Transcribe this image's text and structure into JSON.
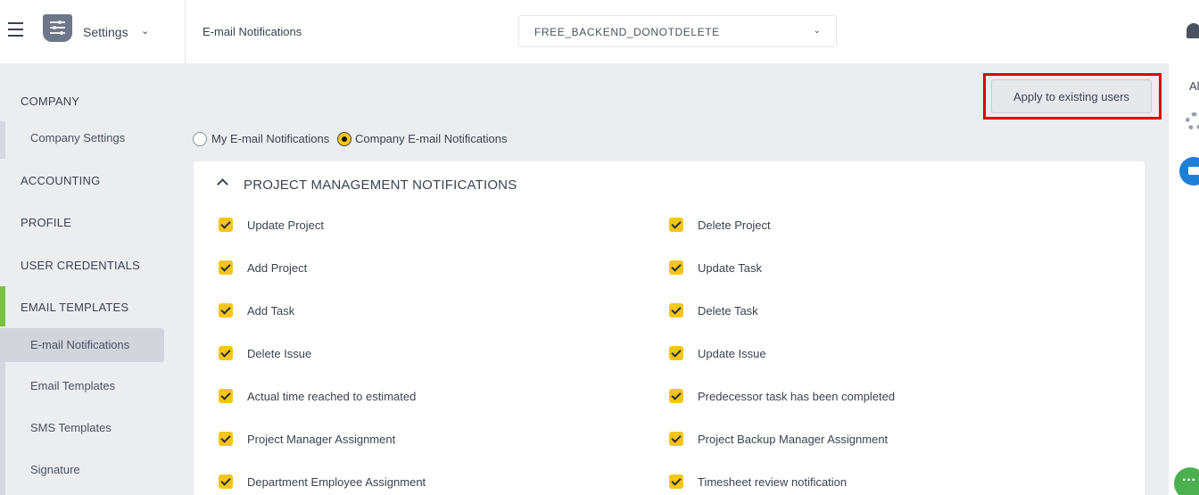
{
  "header": {
    "menu_icon": "hamburger-icon",
    "app_label": "Settings",
    "page_title": "E-mail Notifications",
    "company_select": "FREE_BACKEND_DONOTDELETE"
  },
  "right_rail": {
    "text": "Al",
    "icons": [
      "bell-icon",
      "gear-icon",
      "mail-icon",
      "chat-icon"
    ]
  },
  "sidebar": {
    "sections": [
      {
        "label": "COMPANY"
      },
      {
        "label": "ACCOUNTING"
      },
      {
        "label": "PROFILE"
      },
      {
        "label": "USER CREDENTIALS"
      },
      {
        "label": "EMAIL TEMPLATES"
      }
    ],
    "items": [
      {
        "label": "Company Settings"
      },
      {
        "label": "E-mail Notifications",
        "active": true
      },
      {
        "label": "Email Templates"
      },
      {
        "label": "SMS Templates"
      },
      {
        "label": "Signature"
      }
    ]
  },
  "main": {
    "apply_button": "Apply to existing users",
    "radios": [
      {
        "label": "My E-mail Notifications",
        "checked": false
      },
      {
        "label": "Company E-mail Notifications",
        "checked": true
      }
    ],
    "section_title": "PROJECT MANAGEMENT NOTIFICATIONS",
    "left_column": [
      "Update Project",
      "Add Project",
      "Add Task",
      "Delete Issue",
      "Actual time reached to estimated",
      "Project Manager Assignment",
      "Department Employee Assignment"
    ],
    "right_column": [
      "Delete Project",
      "Update Task",
      "Delete Task",
      "Update Issue",
      "Predecessor task has been completed",
      "Project Backup Manager Assignment",
      "Timesheet review notification"
    ],
    "accent_color": "#f5c518",
    "highlight_color": "#e00000"
  }
}
